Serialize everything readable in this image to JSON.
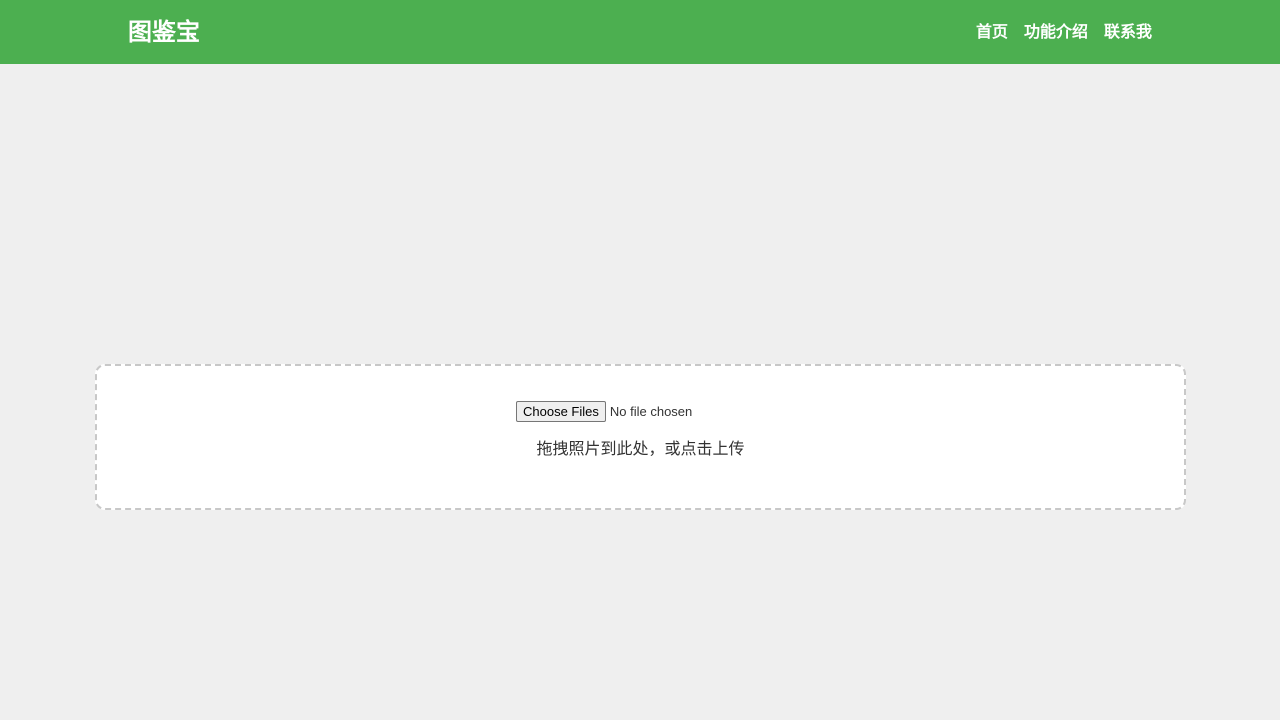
{
  "header": {
    "brand": "图鉴宝",
    "nav": [
      {
        "label": "首页"
      },
      {
        "label": "功能介绍"
      },
      {
        "label": "联系我"
      }
    ]
  },
  "uploader": {
    "button_label": "Choose Files",
    "file_status": "No file chosen",
    "hint": "拖拽照片到此处，或点击上传"
  },
  "colors": {
    "header_bg": "#4caf50",
    "page_bg": "#efefef",
    "dropzone_border": "#c8c8c8"
  }
}
